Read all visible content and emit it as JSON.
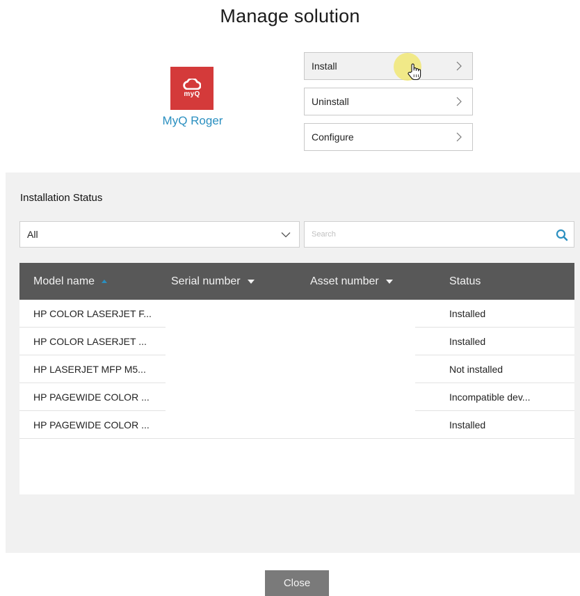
{
  "dialog": {
    "title": "Manage solution"
  },
  "app": {
    "logo_text": "myQ",
    "name": "MyQ Roger",
    "brand_color": "#d43a3a",
    "name_color": "#2a8fc0"
  },
  "actions": [
    {
      "label": "Install",
      "icon": "chevron-right-icon",
      "hovered": true
    },
    {
      "label": "Uninstall",
      "icon": "chevron-right-icon"
    },
    {
      "label": "Configure",
      "icon": "chevron-right-icon"
    }
  ],
  "installation_status": {
    "heading": "Installation Status",
    "filter": {
      "selected": "All",
      "icon": "chevron-down-icon"
    },
    "search": {
      "placeholder": "Search",
      "value": "",
      "icon": "search-icon",
      "icon_color": "#2a8fc0"
    },
    "table": {
      "columns": [
        {
          "label": "Model name",
          "sort": "ascending",
          "sort_color": "#2a8fc0"
        },
        {
          "label": "Serial number",
          "sort": "descending"
        },
        {
          "label": "Asset number",
          "sort": "descending"
        },
        {
          "label": "Status"
        }
      ],
      "rows": [
        {
          "model": "HP COLOR LASERJET F...",
          "serial": "",
          "asset": "",
          "status": "Installed"
        },
        {
          "model": "HP COLOR LASERJET ...",
          "serial": "",
          "asset": "",
          "status": "Installed"
        },
        {
          "model": "HP LASERJET MFP M5...",
          "serial": "",
          "asset": "",
          "status": "Not installed"
        },
        {
          "model": "HP PAGEWIDE COLOR ...",
          "serial": "",
          "asset": "",
          "status": "Incompatible dev..."
        },
        {
          "model": "HP PAGEWIDE COLOR ...",
          "serial": "",
          "asset": "",
          "status": "Installed"
        }
      ]
    }
  },
  "footer": {
    "close_label": "Close"
  }
}
